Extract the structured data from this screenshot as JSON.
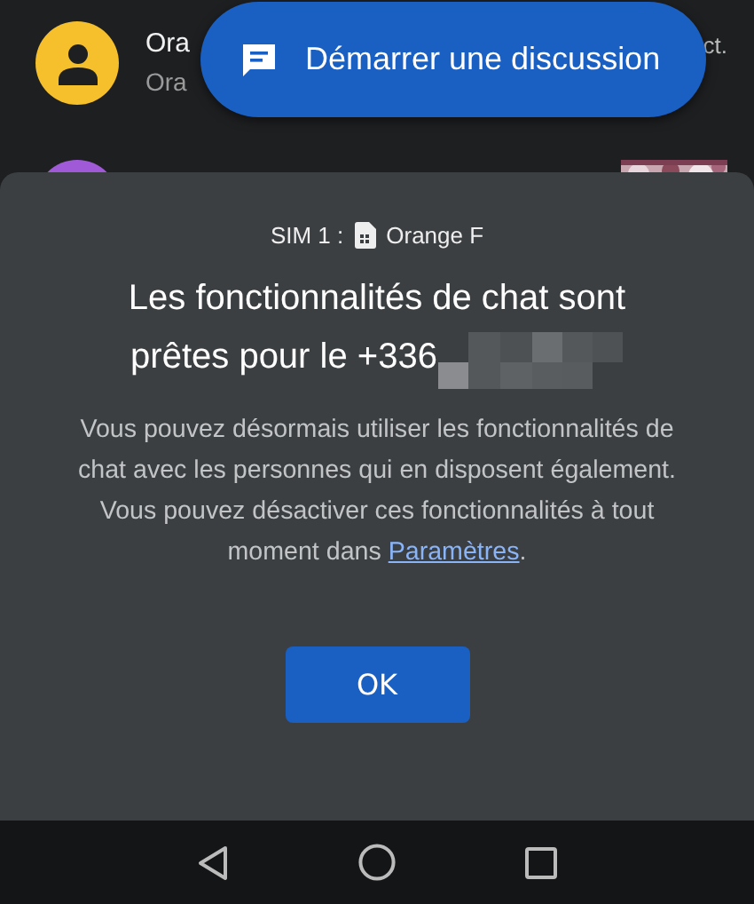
{
  "conversations": [
    {
      "title": "Ora",
      "subtitle": "Ora",
      "time": "ct.",
      "color": "#f6c02c"
    },
    {
      "color": "#a05ad8",
      "kind": "picture"
    }
  ],
  "fab": {
    "label": "Démarrer une discussion"
  },
  "dialog": {
    "sim_label": "SIM 1 :",
    "carrier": "Orange F",
    "title_lines": [
      "Les fonctionnalités de chat sont",
      "prêtes pour le +336"
    ],
    "body": "Vous pouvez désormais utiliser les fonctionnalités de chat avec les personnes qui en disposent également. Vous pouvez désactiver ces fonctionnalités à tout moment dans ",
    "link": "Paramètres",
    "body_end": ".",
    "button": "OK"
  }
}
